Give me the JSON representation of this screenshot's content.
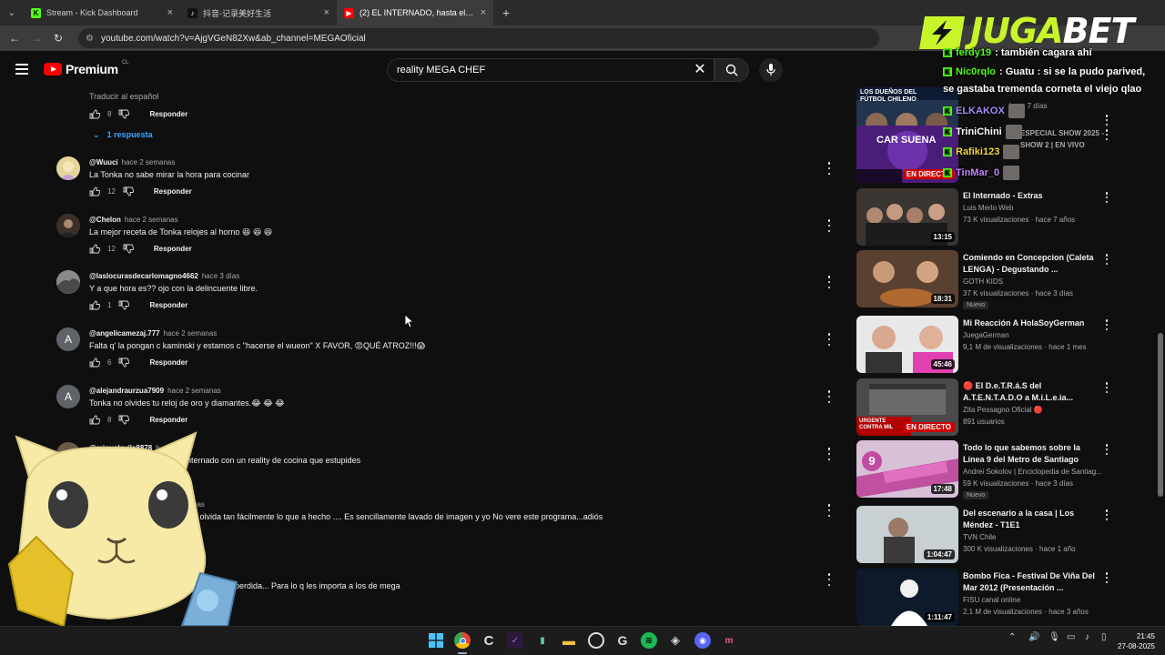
{
  "browser": {
    "tabs": [
      {
        "title": "Stream - Kick Dashboard",
        "favicon": "kick-icon",
        "color": "#53fc18",
        "active": false
      },
      {
        "title": "抖音-记录美好生活",
        "favicon": "tiktok-icon",
        "color": "#000000",
        "active": false
      },
      {
        "title": "(2) EL INTERNADO, hasta el mä",
        "favicon": "youtube-icon",
        "color": "#ff0000",
        "active": true
      }
    ],
    "new_tab": "+",
    "url": "youtube.com/watch?v=AjgVGeN82Xw&ab_channel=MEGAOficial"
  },
  "youtube": {
    "logo_text": "Premium",
    "region": "CL",
    "search_value": "reality MEGA CHEF",
    "translate_label": "Traducir al español",
    "top_likes": "8",
    "reply_label": "Responder",
    "replies_link": "1 respuesta",
    "comments": [
      {
        "author": "@Wuuci",
        "time": "hace 2 semanas",
        "text": "La Tonka no sabe mirar la hora para cocinar",
        "likes": "12",
        "avatar_color": "#d9c27a"
      },
      {
        "author": "@Chelon",
        "time": "hace 2 semanas",
        "text": "La mejor receta de Tonka relojes al horno 😆 😆 😆",
        "likes": "12",
        "avatar_color": "#5a4a3a"
      },
      {
        "author": "@laslocurasdecarlomagno4662",
        "time": "hace 3 días",
        "text": "Y a que hora es?? ojo con la delincuente libre.",
        "likes": "1",
        "avatar_color": "#7a7a7a"
      },
      {
        "author": "@angelicamezaj.777",
        "time": "hace 2 semanas",
        "text": "Falta q' la pongan c kaminski y estamos c \"hacerse el wueon\" X FAVOR, 😡QUÉ ATROZ!!!😱",
        "likes": "6",
        "avatar_letter": "A",
        "avatar_color": "#5f6368"
      },
      {
        "author": "@alejandraurzua7909",
        "time": "hace 2 semanas",
        "text": "Tonka no olvides tu reloj de oro y diamantes.😂 😂 😂",
        "likes": "8",
        "avatar_letter": "A",
        "avatar_color": "#5f6368"
      },
      {
        "author": "@miguelavila8878",
        "time": "h",
        "text": "nternado con un reality de cocina  que estupides",
        "likes": "",
        "avatar_color": "#6b5a4a"
      },
      {
        "author": "",
        "time": "nas",
        "text": "e olvida tan fácilmente lo que a hecho .... Es sencillamente lavado de imagen y yo No vere este programa...adiós",
        "likes": "",
        "avatar_color": "#0f0f0f"
      },
      {
        "author": "",
        "time": "s",
        "text": "perdida... Para lo q les importa a los de mega",
        "likes": "",
        "avatar_color": "#0f0f0f"
      }
    ]
  },
  "sidebar": {
    "videos": [
      {
        "title": "",
        "channel": "",
        "meta": "hace 7 días",
        "duration": "26",
        "thumb_text": "LOS DUEÑOS DEL FÚTBOL CHILENO",
        "thumb_color": "#2a3a5a"
      },
      {
        "title": "ESPECIAL SHOW 2025 - SHOW 2 | EN VIVO",
        "channel": "",
        "meta": "",
        "live": "EN DIRECTO",
        "thumb_text": "CAR SUENA",
        "thumb_color": "#5a2a8a"
      },
      {
        "title": "El Internado - Extras",
        "channel": "Luis Merlo Web",
        "meta": "73 K visualizaciones · hace 7 años",
        "duration": "13:15",
        "thumb_color": "#3a3530"
      },
      {
        "title": "Comiendo en Concepcion (Caleta LENGA) - Degustando ...",
        "channel": "GOTH KIDS",
        "meta": "37 K visualizaciones · hace 3 días",
        "badge": "Nuevo",
        "duration": "18:31",
        "thumb_color": "#6a4a30"
      },
      {
        "title": "Mi Reacción A HolaSoyGerman",
        "channel": "JuegaGerman",
        "meta": "9,1 M de visualizaciones · hace 1 mes",
        "duration": "45:46",
        "thumb_color": "#d04fa0"
      },
      {
        "title": "🔴 El D.e.T.R.á.S del A.T.E.N.T.A.D.O a M.i.L.e.ia...",
        "channel": "Zita Pessagno Oficial 🔴",
        "meta": "891 usuarios",
        "live": "EN DIRECTO",
        "thumb_text": "URGENTE CONTRA MIL",
        "thumb_color": "#4a4a4a"
      },
      {
        "title": "Todo lo que sabemos sobre la Línea 9 del Metro de Santiago",
        "channel": "Andrei Sokolov | Enciclopedia de Santiag...",
        "meta": "59 K visualizaciones · hace 3 días",
        "badge": "Nuevo",
        "duration": "17:48",
        "thumb_text": "9",
        "thumb_color": "#c8a0c8"
      },
      {
        "title": "Del escenario a la casa | Los Méndez - T1E1",
        "channel": "TVN Chile",
        "meta": "300 K visualizaciones · hace 1 año",
        "duration": "1:04:47",
        "thumb_color": "#8a9aa0"
      },
      {
        "title": "Bombo Fica - Festival De Viña Del Mar 2012 (Presentación ...",
        "channel": "FISU canal online",
        "meta": "2,1 M de visualizaciones · hace 3 años",
        "duration": "1:11:47",
        "thumb_color": "#1a2a3a"
      }
    ]
  },
  "overlay": {
    "brand": "JUGABET",
    "brand_color": "#c8f52a",
    "chat": [
      {
        "user": "ferdy19",
        "text": ": también cagara ahí"
      },
      {
        "user": "Nic0rqlo",
        "text": ": Guatu : si se la pudo parived,"
      },
      {
        "user": "",
        "text": "se gastaba tremenda corneta el viejo qlao"
      },
      {
        "user": "ELKAKOX",
        "text": ""
      },
      {
        "user": "TriniChini",
        "text": ""
      },
      {
        "user": "Rafiki123",
        "text": ""
      },
      {
        "user": "TinMar_0",
        "text": ""
      }
    ]
  },
  "taskbar": {
    "time": "21:45",
    "date": "27-08-2025"
  }
}
